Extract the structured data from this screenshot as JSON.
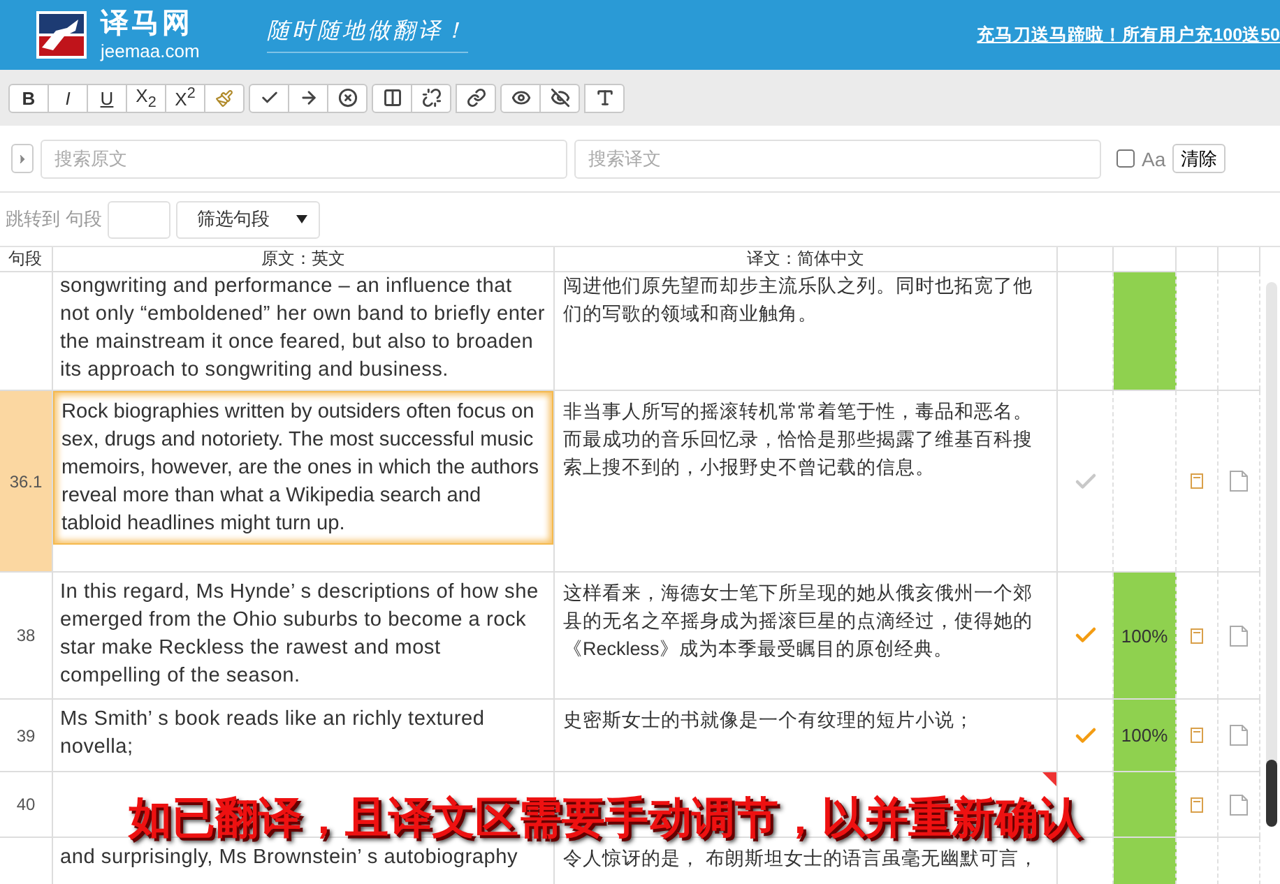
{
  "header": {
    "logo_title": "译马网",
    "logo_domain": "jeemaa.com",
    "slogan": "随时随地做翻译！",
    "promo": "充马刀送马蹄啦！所有用户充100送50"
  },
  "toolbar": {
    "format_buttons": [
      "B",
      "I",
      "U",
      "X$_{2}$",
      "X$^{2}$"
    ]
  },
  "search": {
    "source_placeholder": "搜索原文",
    "target_placeholder": "搜索译文",
    "case_label": "Aa",
    "case_checked": false,
    "clear_button": "清除"
  },
  "jump": {
    "label": "跳转到",
    "segment_label": "句段",
    "filter": "筛选句段"
  },
  "table": {
    "columns": [
      "句段",
      "原文：英文",
      "译文：简体中文"
    ],
    "rows": [
      {
        "id": "",
        "source": "songwriting and performance – an influence that not only “emboldened” her own band to briefly enter the mainstream it once feared, but also to broaden its approach to songwriting and business.",
        "target": "闯进他们原先望而却步主流乐队之列。同时也拓宽了他们的写歌的领域和商业触角。",
        "matched": true,
        "match": "",
        "selected": false
      },
      {
        "id": "36.1",
        "source": "Rock biographies written by outsiders often focus on sex, drugs and notoriety. The most successful music memoirs, however, are the ones in which the authors reveal more than what a Wikipedia search and tabloid headlines might turn up.",
        "target": "非当事人所写的摇滚转机常常着笔于性，毒品和恶名。而最成功的音乐回忆录，恰恰是那些揭露了维基百科搜索上搜不到的，小报野史不曾记载的信息。",
        "confirmed": false,
        "matched": false,
        "match": "",
        "selected": true,
        "tools": true
      },
      {
        "id": "38",
        "source": "In this regard, Ms Hynde’ s descriptions of how she emerged from the Ohio suburbs to become a rock star make Reckless the rawest and most compelling of the season.",
        "target": "这样看来，海德女士笔下所呈现的她从俄亥俄州一个郊县的无名之卒摇身成为摇滚巨星的点滴经过，使得她的《Reckless》成为本季最受瞩目的原创经典。",
        "confirmed": true,
        "matched": true,
        "match": "100%",
        "selected": false,
        "tools": true
      },
      {
        "id": "39",
        "source": "Ms Smith’ s book reads like an richly textured novella;",
        "target": "史密斯女士的书就像是一个有纹理的短片小说；",
        "confirmed": true,
        "matched": true,
        "match": "100%",
        "selected": false,
        "tools": true
      },
      {
        "id": "40",
        "source": "",
        "target": "",
        "matched": true,
        "match": "",
        "selected": false,
        "flagged": true,
        "tools": true
      },
      {
        "id": "",
        "source": "and surprisingly, Ms Brownstein’ s autobiography",
        "target": "令人惊讶的是， 布朗斯坦女士的语言虽毫无幽默可言，",
        "matched": true,
        "match": "",
        "selected": false
      }
    ]
  },
  "caption": "如已翻译，且译文区需要手动调节，以并重新确认"
}
